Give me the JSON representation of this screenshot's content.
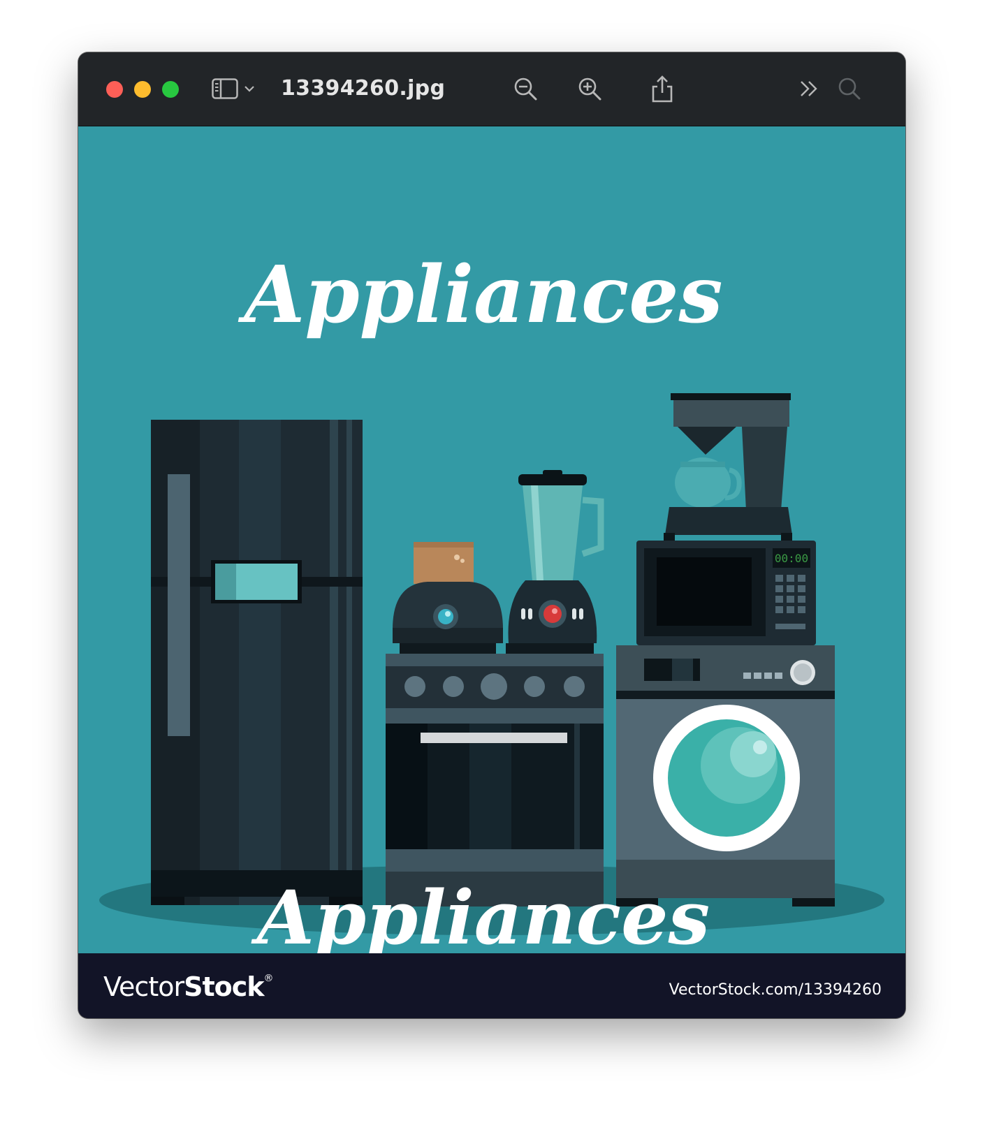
{
  "window": {
    "title": "13394260.jpg"
  },
  "toolbar": {
    "icons": [
      "sidebar-toggle-icon",
      "chevron-down-icon",
      "zoom-out-icon",
      "zoom-in-icon",
      "share-icon",
      "more-chevrons-icon",
      "search-icon"
    ]
  },
  "image": {
    "heading": "Appliances",
    "subheading": "Appliances",
    "microwave_display": "00:00",
    "footer_brand_light": "Vector",
    "footer_brand_bold": "Stock",
    "footer_brand_mark": "®",
    "footer_url": "VectorStock.com/13394260",
    "colors": {
      "background": "#339aa5",
      "dark_appliance": "#1f2d35",
      "accent_teal": "#3ab0a8",
      "footer": "#121427"
    }
  }
}
